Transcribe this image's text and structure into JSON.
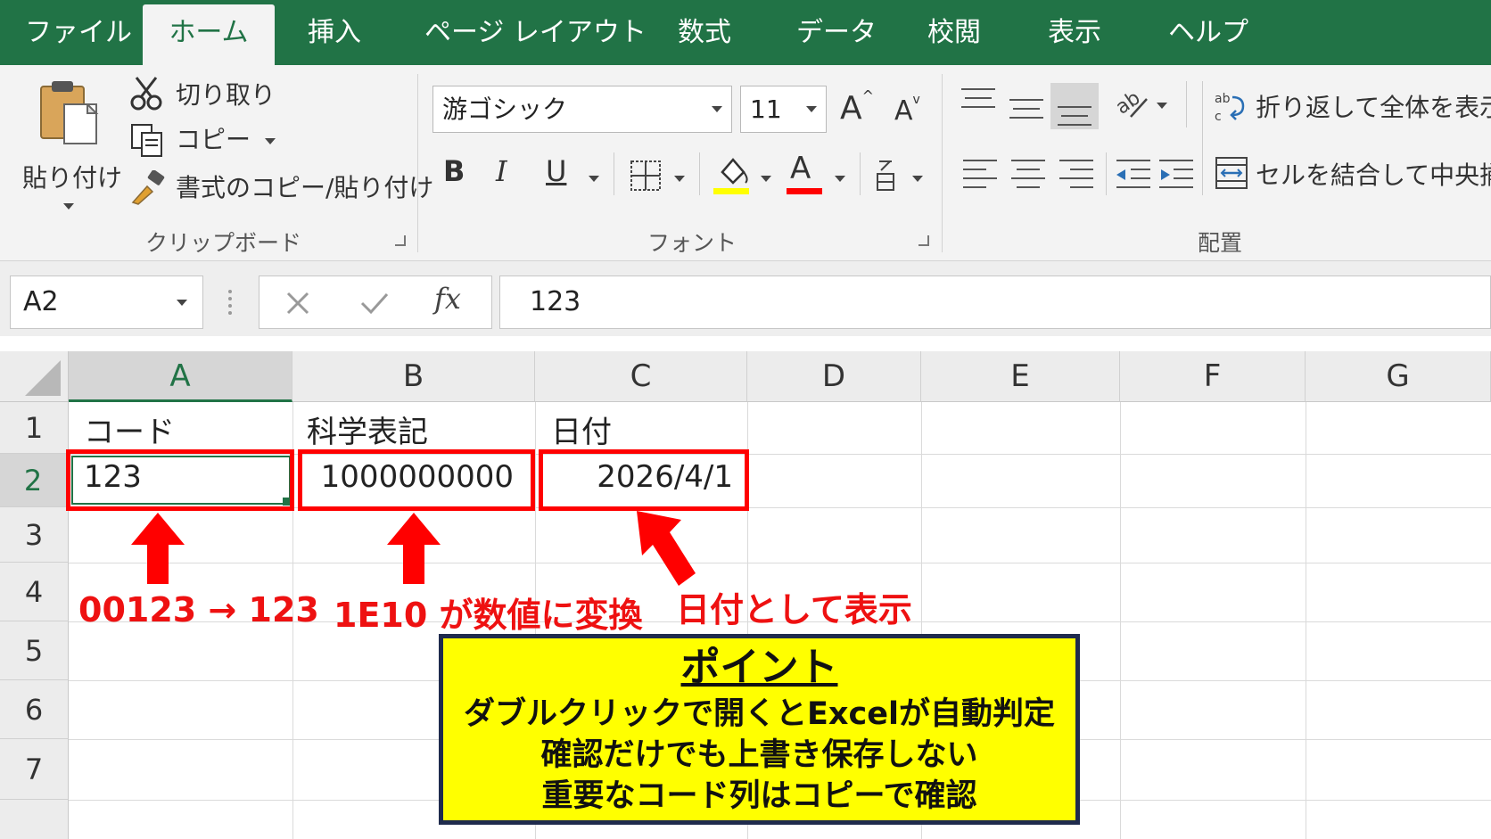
{
  "tabs": [
    "ファイル",
    "ホーム",
    "挿入",
    "ページ レイアウト",
    "数式",
    "データ",
    "校閲",
    "表示",
    "ヘルプ"
  ],
  "ribbon": {
    "clipboard": {
      "paste": "貼り付け",
      "cut": "切り取り",
      "copy": "コピー",
      "format_painter": "書式のコピー/貼り付け",
      "group": "クリップボード"
    },
    "font": {
      "name": "游ゴシック",
      "size": "11",
      "bold": "B",
      "italic": "I",
      "underline": "U",
      "grow": "A",
      "shrink": "A",
      "font_color": "A",
      "group": "フォント"
    },
    "alignment": {
      "wrap": "折り返して全体を表示す",
      "merge": "セルを結合して中央揃え",
      "group": "配置"
    }
  },
  "formula_bar": {
    "name_box": "A2",
    "fx": "fx",
    "value": "123"
  },
  "sheet": {
    "columns": [
      "A",
      "B",
      "C",
      "D",
      "E",
      "F",
      "G"
    ],
    "rows": [
      "1",
      "2",
      "3",
      "4",
      "5",
      "6",
      "7"
    ],
    "cells": {
      "A1": "コード",
      "B1": "科学表記",
      "C1": "日付",
      "A2": "123",
      "B2": "1000000000",
      "C2": "2026/4/1"
    }
  },
  "annotations": {
    "a": "00123 → 123",
    "b": "1E10 が数値に変換",
    "c": "日付として表示"
  },
  "note": {
    "title": "ポイント",
    "lines": [
      "ダブルクリックで開くとExcelが自動判定",
      "確認だけでも上書き保存しない",
      "重要なコード列はコピーで確認"
    ]
  },
  "colors": {
    "excel_green": "#217346",
    "annotation_red": "#ff0000",
    "note_yellow": "#ffff00",
    "note_border": "#1f2b4d",
    "highlight_yellow": "#ffff00"
  }
}
